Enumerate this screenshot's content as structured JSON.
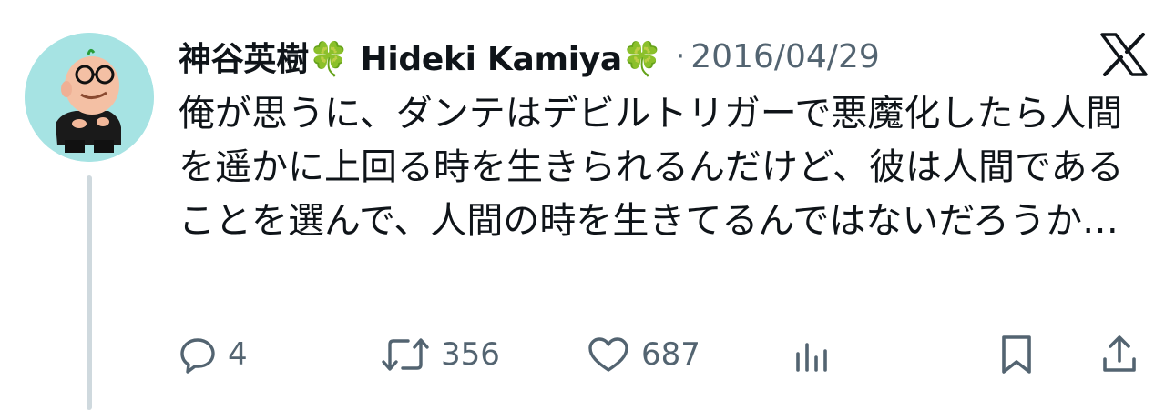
{
  "tweet": {
    "author": "神谷英樹🍀 Hideki Kamiya🍀",
    "separator": "·",
    "date": "2016/04/29",
    "text": "俺が思うに、ダンテはデビルトリガーで悪魔化したら人間を遥かに上回る時を生きられるんだけど、彼は人間であることを選んで、人間の時を生きてるんではないだろうか…"
  },
  "actions": {
    "reply_count": "4",
    "retweet_count": "356",
    "like_count": "687"
  },
  "colors": {
    "text": "#0f1419",
    "muted": "#536471",
    "thread_line": "#cfd9de",
    "avatar_bg": "#a6e3e3"
  },
  "icons": [
    "x-logo-icon",
    "reply-icon",
    "retweet-icon",
    "like-icon",
    "views-icon",
    "bookmark-icon",
    "share-icon"
  ]
}
